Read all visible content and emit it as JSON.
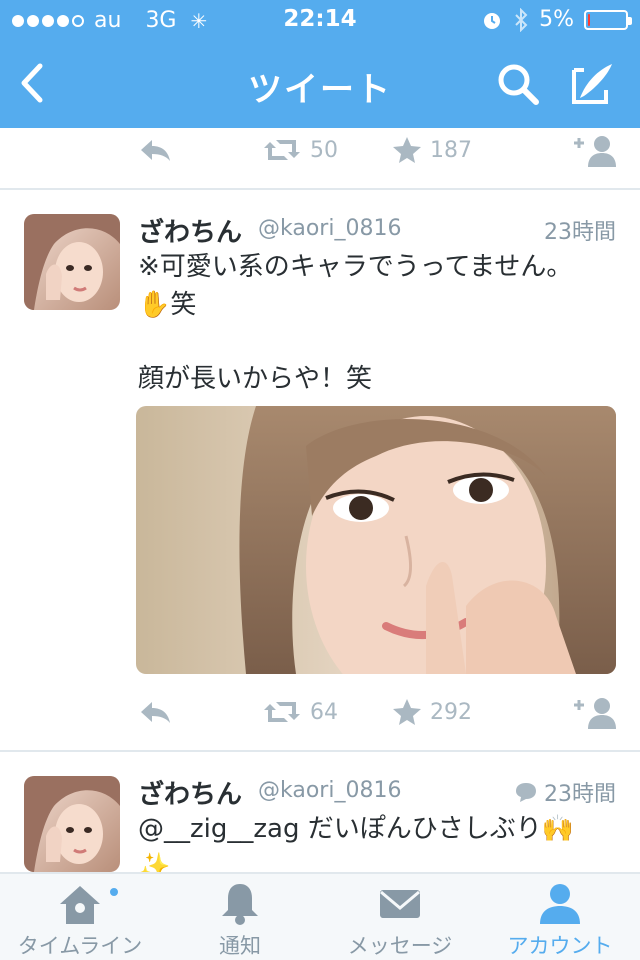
{
  "status_bar": {
    "carrier": "au",
    "network": "3G",
    "time": "22:14",
    "battery": "5%",
    "battery_level": 0.05,
    "signal_bars": 4
  },
  "nav": {
    "title": "ツイート",
    "back_icon": "chevron-left-icon",
    "search_icon": "search-icon",
    "compose_icon": "compose-icon"
  },
  "top_actions": {
    "retweets": "50",
    "favorites": "187"
  },
  "tweets": [
    {
      "name": "ざわちん",
      "handle": "@kaori_0816",
      "time": "23時間",
      "text_line1": "※可愛い系のキャラでうってません。",
      "text_line2": "✋笑",
      "text_line3": "顔が長いからや！笑",
      "retweets": "64",
      "favorites": "292"
    },
    {
      "name": "ざわちん",
      "handle": "@kaori_0816",
      "time": "23時間",
      "text_line1": "@__zig__zag だいぽんひさしぶり🙌",
      "text_line2": "✨"
    }
  ],
  "tabs": [
    {
      "label": "タイムライン",
      "icon": "home-icon"
    },
    {
      "label": "通知",
      "icon": "bell-icon"
    },
    {
      "label": "メッセージ",
      "icon": "envelope-icon"
    },
    {
      "label": "アカウント",
      "icon": "person-icon"
    }
  ],
  "colors": {
    "brand": "#55acee",
    "action_gray": "#aab8c2",
    "battery_low": "#ff3b30"
  }
}
